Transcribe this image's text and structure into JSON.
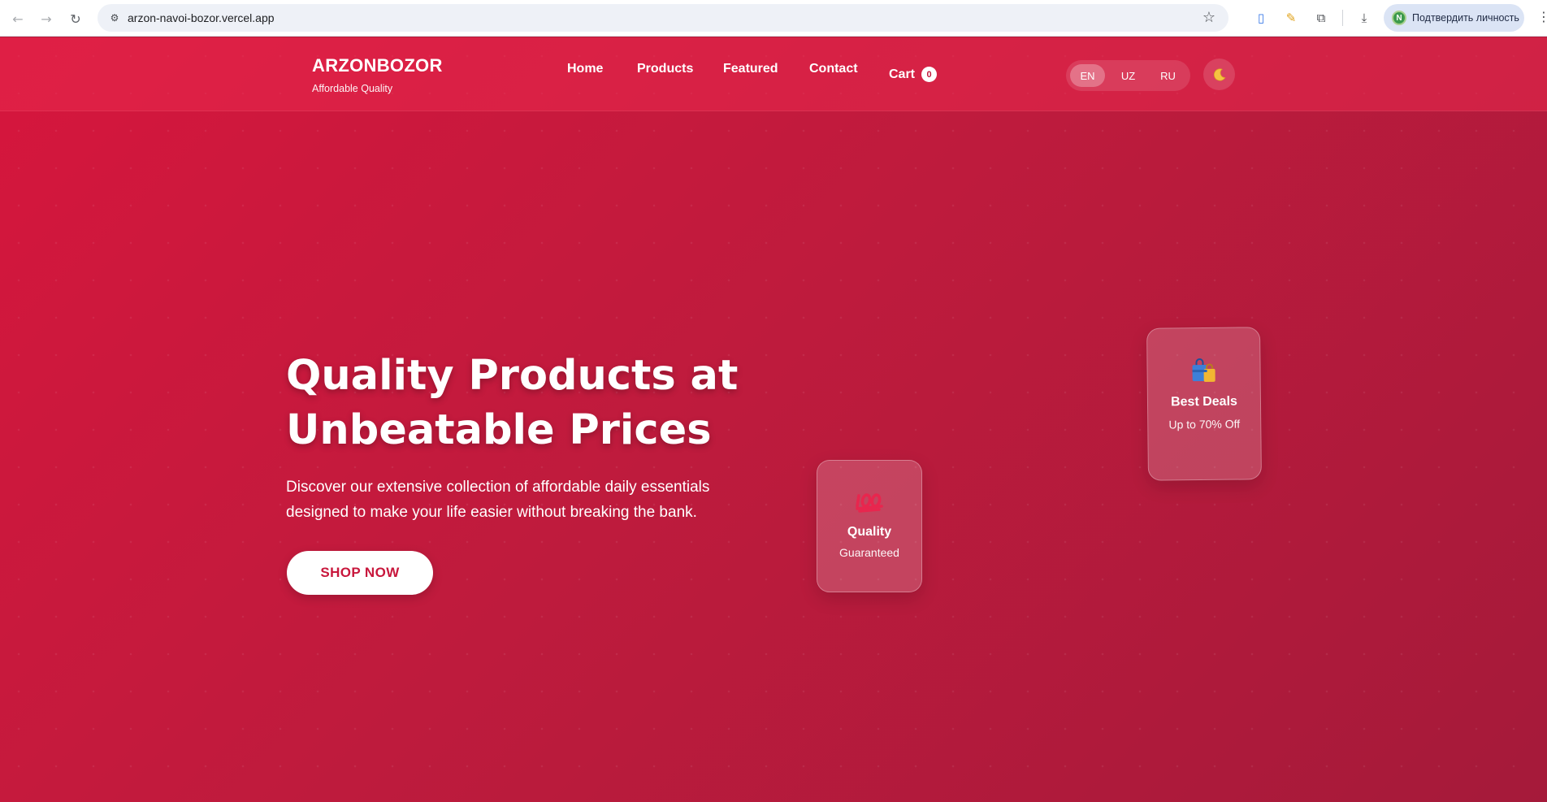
{
  "browser": {
    "url": "arzon-navoi-bozor.vercel.app",
    "profile_label": "Подтвердить личность",
    "profile_initial": "N"
  },
  "site": {
    "brand": "ARZONBOZOR",
    "tagline": "Affordable Quality",
    "nav": [
      "Home",
      "Products",
      "Featured",
      "Contact"
    ],
    "cart": {
      "label": "Cart",
      "count": "0"
    },
    "languages": [
      "EN",
      "UZ",
      "RU"
    ],
    "active_language": "EN",
    "theme_toggle_icon": "moon-icon",
    "colors": {
      "primary": "#d6163d",
      "dark": "#a51a3a",
      "button_text": "#c8173c"
    }
  },
  "hero": {
    "title_line1": "Quality Products at",
    "title_line2": "Unbeatable Prices",
    "description": "Discover our extensive collection of affordable daily essentials designed to make your life easier without breaking the bank.",
    "cta": "SHOP NOW"
  },
  "cards": {
    "quality": {
      "icon": "hundred-points-icon",
      "title": "Quality",
      "subtitle": "Guaranteed"
    },
    "deals": {
      "icon": "shopping-bags-icon",
      "title": "Best Deals",
      "subtitle": "Up to 70% Off"
    }
  }
}
